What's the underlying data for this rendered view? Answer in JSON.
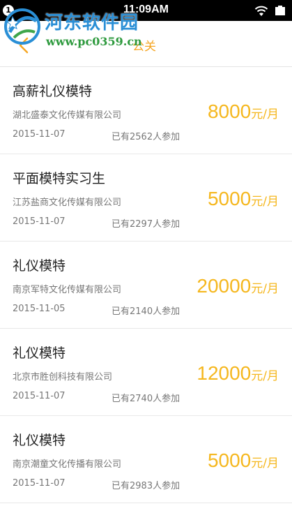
{
  "status_bar": {
    "notification_count": "1",
    "time": "11:09AM",
    "icons": [
      "wifi-icon",
      "battery-icon"
    ]
  },
  "header": {
    "title": "公关",
    "back_icon": "chevron-left-icon",
    "accent_color": "#f5a623"
  },
  "watermark": {
    "title": "河东软件园",
    "url": "www.pc0359.cn"
  },
  "jobs": [
    {
      "title": "高薪礼仪模特",
      "company": "湖北盛泰文化传媒有限公司",
      "date": "2015-11-07",
      "participants": "已有2562人参加",
      "salary": "8000",
      "unit": "元/月"
    },
    {
      "title": "平面模特实习生",
      "company": "江苏盐商文化传媒有限公司",
      "date": "2015-11-07",
      "participants": "已有2297人参加",
      "salary": "5000",
      "unit": "元/月"
    },
    {
      "title": "礼仪模特",
      "company": "南京军特文化传媒有限公司",
      "date": "2015-11-05",
      "participants": "已有2140人参加",
      "salary": "20000",
      "unit": "元/月"
    },
    {
      "title": "礼仪模特",
      "company": "北京市胜创科技有限公司",
      "date": "2015-11-07",
      "participants": "已有2740人参加",
      "salary": "12000",
      "unit": "元/月"
    },
    {
      "title": "礼仪模特",
      "company": "南京潮童文化传播有限公司",
      "date": "2015-11-07",
      "participants": "已有2983人参加",
      "salary": "5000",
      "unit": "元/月"
    }
  ],
  "colors": {
    "salary": "#f5b71e",
    "primary_text": "#222222",
    "secondary_text": "#777777",
    "status_bar": "#000000"
  }
}
